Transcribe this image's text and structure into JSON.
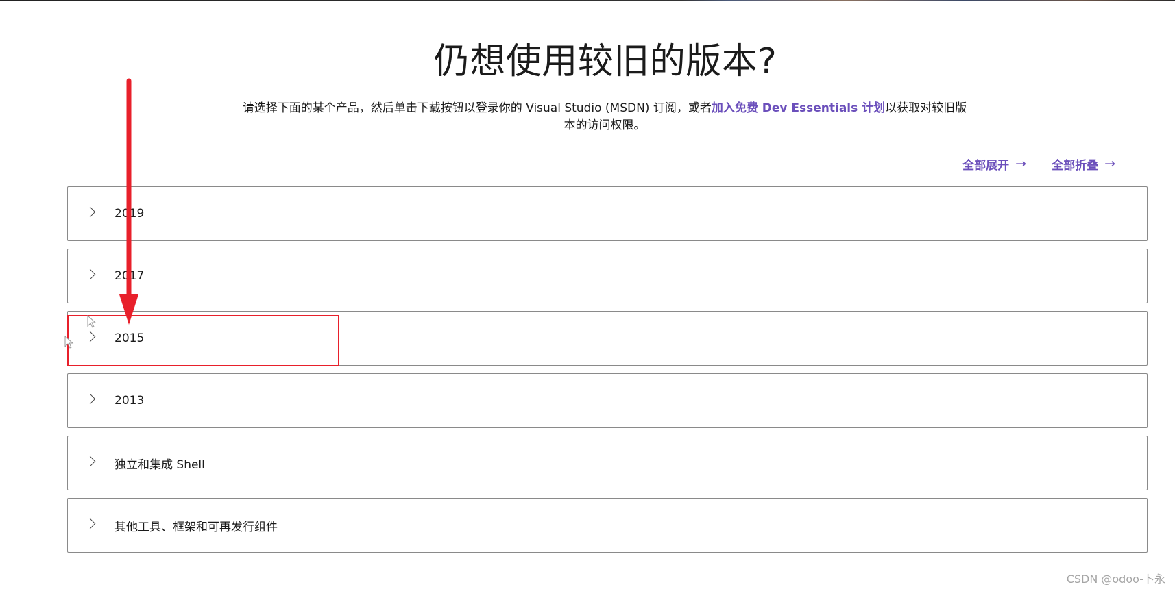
{
  "page": {
    "title": "仍想使用较旧的版本?",
    "subtitle_before": "请选择下面的某个产品，然后单击下载按钮以登录你的 Visual Studio (MSDN) 订阅，或者",
    "subtitle_link": "加入免费 Dev Essentials 计划",
    "subtitle_after": "以获取对较旧版本的访问权限。"
  },
  "controls": {
    "expand_all": "全部展开",
    "collapse_all": "全部折叠",
    "arrow": "→"
  },
  "versions": [
    {
      "label": "2019"
    },
    {
      "label": "2017"
    },
    {
      "label": "2015"
    },
    {
      "label": "2013"
    },
    {
      "label": "独立和集成 Shell"
    },
    {
      "label": "其他工具、框架和可再发行组件"
    }
  ],
  "annotation": {
    "color": "#e8202b",
    "highlighted_item": "2015"
  },
  "colors": {
    "accent": "#6b4fbb",
    "border": "#8a8a8a"
  },
  "watermark": "CSDN @odoo-卜永"
}
